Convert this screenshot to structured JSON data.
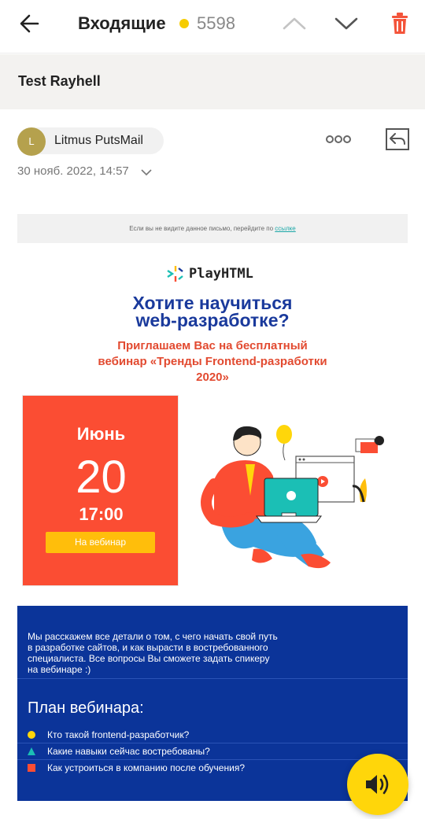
{
  "header": {
    "folder_title": "Входящие",
    "unread_count": "5598",
    "unread_dot_color": "#f6cc00",
    "icons": [
      "back-arrow-icon",
      "chevron-up-icon",
      "chevron-down-icon",
      "trash-icon"
    ]
  },
  "message": {
    "subject": "Test Rayhell",
    "sender_initial": "L",
    "sender_name": "Litmus PutsMail",
    "date": "30 нояб. 2022, 14:57"
  },
  "email": {
    "preheader_text": "Если вы не видите данное письмо, перейдите по",
    "preheader_link": "ссылке",
    "logo_text": "PlayHTML",
    "headline_line1": "Хотите научиться",
    "headline_line2": "web-разработке?",
    "subhead_line1": "Приглашаем Вас на бесплатный",
    "subhead_line2": "вебинар «Тренды Frontend-разработки",
    "subhead_line3": "2020»",
    "event": {
      "month": "Июнь",
      "day": "20",
      "time": "17:00",
      "button_label": "На вебинар"
    },
    "info_text_line1": "Мы расскажем все детали о том, с чего начать свой путь",
    "info_text_line2": "в разработке сайтов, и как вырасти в востребованного",
    "info_text_line3": "специалиста. Все вопросы Вы сможете задать спикеру",
    "info_text_line4": "на вебинаре :)",
    "plan_title": "План вебинара:",
    "plan_items": [
      {
        "label": "Кто такой frontend-разработчик?",
        "marker": "circle",
        "color": "#ffd60a"
      },
      {
        "label": "Какие навыки сейчас востребованы?",
        "marker": "triangle",
        "color": "#1bbfb5"
      },
      {
        "label": "Как устроиться в компанию после обучения?",
        "marker": "square",
        "color": "#fb4d33"
      }
    ]
  },
  "colors": {
    "accent_yellow": "#ffd60a",
    "trash_red": "#f4543a",
    "headline_blue": "#1a3a9c",
    "subhead_red": "#e24a30",
    "card_red": "#fb4d33",
    "info_blue": "#0b3499"
  }
}
